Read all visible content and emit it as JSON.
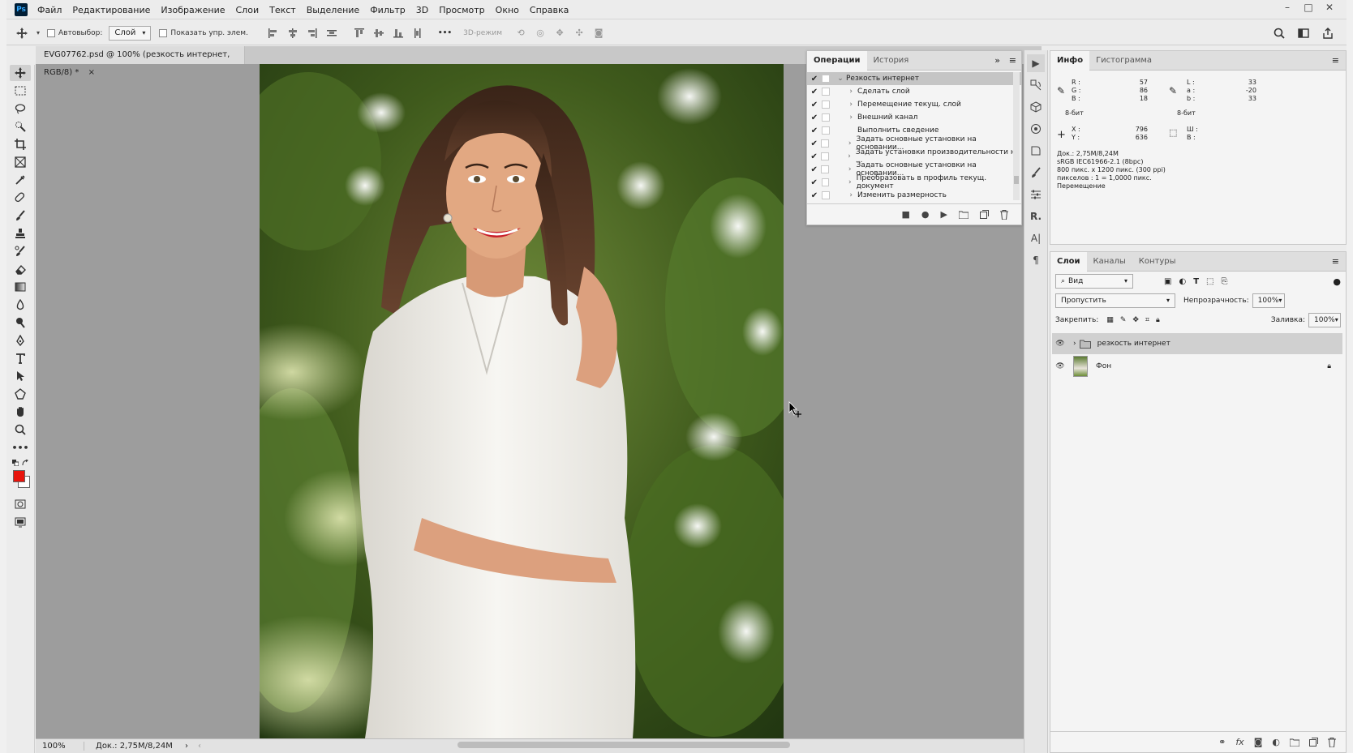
{
  "app": {
    "logo": "Ps",
    "menu": [
      "Файл",
      "Редактирование",
      "Изображение",
      "Слои",
      "Текст",
      "Выделение",
      "Фильтр",
      "3D",
      "Просмотр",
      "Окно",
      "Справка"
    ],
    "window_controls": [
      "–",
      "□",
      "✕"
    ]
  },
  "options": {
    "autoselect_label": "Автовыбор:",
    "autoselect_value": "Слой",
    "show_transform_label": "Показать упр. элем.",
    "mode_3d": "3D-режим",
    "more": "•••"
  },
  "document": {
    "tab_title": "EVG07762.psd @ 100% (резкость интернет, RGB/8) *",
    "tab_close": "×",
    "zoom": "100%",
    "doc_size": "Док.: 2,75M/8,24M"
  },
  "actions_panel": {
    "tabs": [
      "Операции",
      "История"
    ],
    "items": [
      {
        "label": "Резкость интернет",
        "checked": true,
        "expanded": true,
        "level": 0
      },
      {
        "label": "Сделать слой",
        "checked": true,
        "level": 1
      },
      {
        "label": "Перемещение текущ. слой",
        "checked": true,
        "level": 1
      },
      {
        "label": "Внешний канал",
        "checked": true,
        "level": 1
      },
      {
        "label": "Выполнить сведение",
        "checked": true,
        "level": 1,
        "nochev": true
      },
      {
        "label": "Задать основные установки на основании...",
        "checked": true,
        "level": 1
      },
      {
        "label": "Задать установки производительности на ...",
        "checked": true,
        "level": 1
      },
      {
        "label": "Задать основные установки на основании...",
        "checked": true,
        "level": 1
      },
      {
        "label": "Преобразовать в профиль текущ. документ",
        "checked": true,
        "level": 1
      },
      {
        "label": "Изменить размерность",
        "checked": true,
        "level": 1
      }
    ]
  },
  "info_panel": {
    "tabs": [
      "Инфо",
      "Гистограмма"
    ],
    "rgb": {
      "R_label": "R :",
      "G_label": "G :",
      "B_label": "B :",
      "R": "57",
      "G": "86",
      "B": "18"
    },
    "lab": {
      "L_label": "L :",
      "a_label": "a :",
      "b_label": "b :",
      "L": "33",
      "a": "-20",
      "b": "33"
    },
    "bits_left": "8-бит",
    "bits_right": "8-бит",
    "xy": {
      "X_label": "X :",
      "Y_label": "Y :",
      "X": "796",
      "Y": "636"
    },
    "wh": {
      "W_label": "Ш :",
      "H_label": "В :"
    },
    "doc_lines": [
      "Док.: 2,75M/8,24M",
      "sRGB IEC61966-2.1 (8bpc)",
      "800 пикс. x 1200 пикс. (300 ppi)",
      "пикселов : 1 = 1,0000 пикс.",
      "Перемещение"
    ]
  },
  "layers_panel": {
    "tabs": [
      "Слои",
      "Каналы",
      "Контуры"
    ],
    "filter_label": "Вид",
    "blend_mode": "Пропустить",
    "opacity_label": "Непрозрачность:",
    "opacity": "100%",
    "lock_label": "Закрепить:",
    "fill_label": "Заливка:",
    "fill": "100%",
    "layers": [
      {
        "name": "резкость интернет",
        "type": "group",
        "selected": true
      },
      {
        "name": "Фон",
        "type": "image",
        "locked": true
      }
    ]
  },
  "colors": {
    "foreground": "#e8140c",
    "background": "#ffffff",
    "accent": "#31a8ff"
  }
}
